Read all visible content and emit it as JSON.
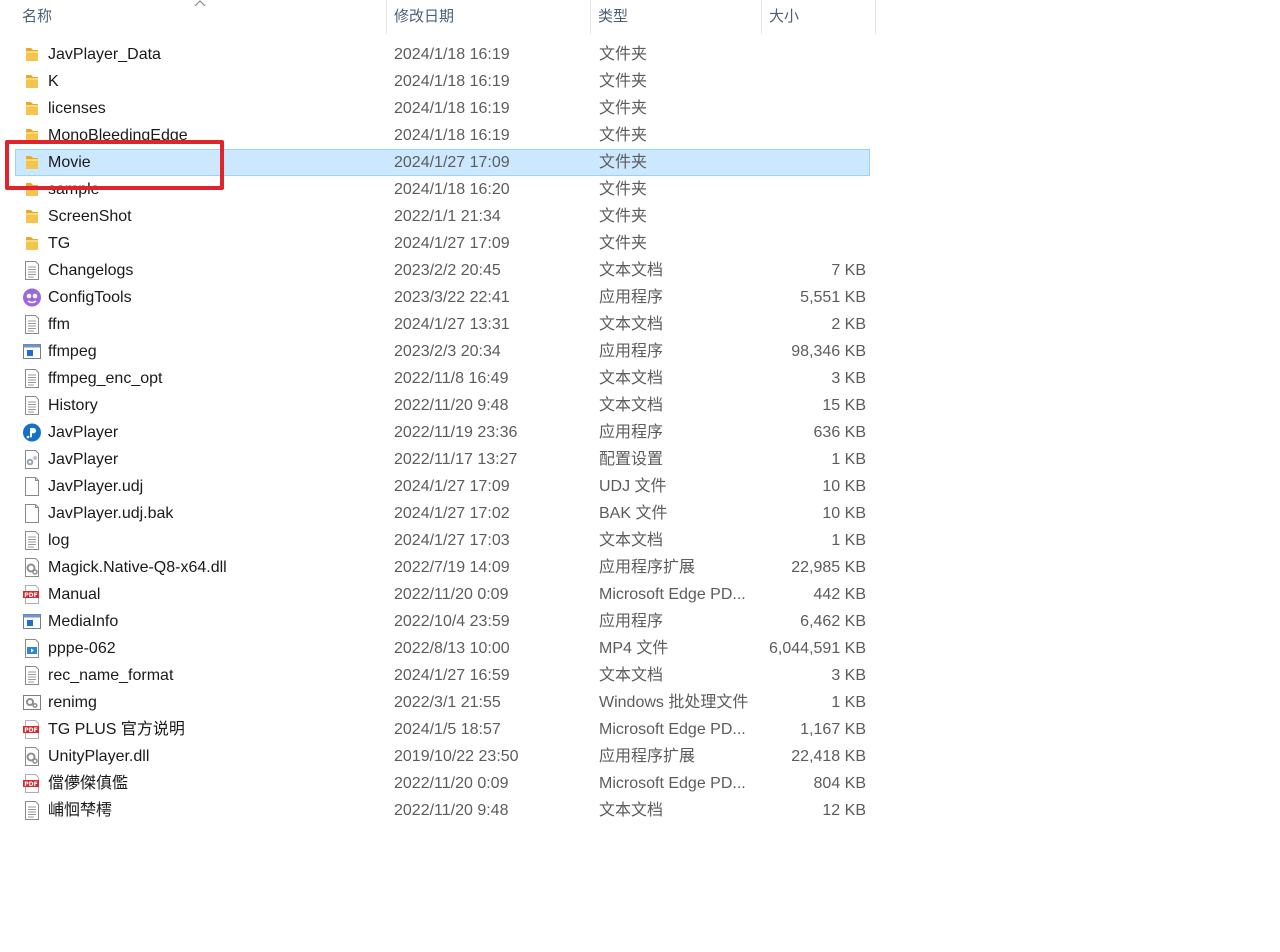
{
  "columns": {
    "name": "名称",
    "date": "修改日期",
    "type": "类型",
    "size": "大小"
  },
  "files": [
    {
      "name": "JavPlayer_Data",
      "date": "2024/1/18 16:19",
      "type": "文件夹",
      "size": "",
      "icon": "folder-icon"
    },
    {
      "name": "K",
      "date": "2024/1/18 16:19",
      "type": "文件夹",
      "size": "",
      "icon": "folder-icon"
    },
    {
      "name": "licenses",
      "date": "2024/1/18 16:19",
      "type": "文件夹",
      "size": "",
      "icon": "folder-icon"
    },
    {
      "name": "MonoBleedingEdge",
      "date": "2024/1/18 16:19",
      "type": "文件夹",
      "size": "",
      "icon": "folder-icon"
    },
    {
      "name": "Movie",
      "date": "2024/1/27 17:09",
      "type": "文件夹",
      "size": "",
      "icon": "folder-icon",
      "selected": true
    },
    {
      "name": "sample",
      "date": "2024/1/18 16:20",
      "type": "文件夹",
      "size": "",
      "icon": "folder-icon"
    },
    {
      "name": "ScreenShot",
      "date": "2022/1/1 21:34",
      "type": "文件夹",
      "size": "",
      "icon": "folder-icon"
    },
    {
      "name": "TG",
      "date": "2024/1/27 17:09",
      "type": "文件夹",
      "size": "",
      "icon": "folder-icon"
    },
    {
      "name": "Changelogs",
      "date": "2023/2/2 20:45",
      "type": "文本文档",
      "size": "7 KB",
      "icon": "text-document-icon"
    },
    {
      "name": "ConfigTools",
      "date": "2023/3/22 22:41",
      "type": "应用程序",
      "size": "5,551 KB",
      "icon": "config-tools-app-icon"
    },
    {
      "name": "ffm",
      "date": "2024/1/27 13:31",
      "type": "文本文档",
      "size": "2 KB",
      "icon": "text-document-icon"
    },
    {
      "name": "ffmpeg",
      "date": "2023/2/3 20:34",
      "type": "应用程序",
      "size": "98,346 KB",
      "icon": "application-window-icon"
    },
    {
      "name": "ffmpeg_enc_opt",
      "date": "2022/11/8 16:49",
      "type": "文本文档",
      "size": "3 KB",
      "icon": "text-document-icon"
    },
    {
      "name": "History",
      "date": "2022/11/20 9:48",
      "type": "文本文档",
      "size": "15 KB",
      "icon": "text-document-icon"
    },
    {
      "name": "JavPlayer",
      "date": "2022/11/19 23:36",
      "type": "应用程序",
      "size": "636 KB",
      "icon": "javplayer-app-icon"
    },
    {
      "name": "JavPlayer",
      "date": "2022/11/17 13:27",
      "type": "配置设置",
      "size": "1 KB",
      "icon": "config-settings-icon"
    },
    {
      "name": "JavPlayer.udj",
      "date": "2024/1/27 17:09",
      "type": "UDJ 文件",
      "size": "10 KB",
      "icon": "blank-file-icon"
    },
    {
      "name": "JavPlayer.udj.bak",
      "date": "2024/1/27 17:02",
      "type": "BAK 文件",
      "size": "10 KB",
      "icon": "blank-file-icon"
    },
    {
      "name": "log",
      "date": "2024/1/27 17:03",
      "type": "文本文档",
      "size": "1 KB",
      "icon": "text-document-icon"
    },
    {
      "name": "Magick.Native-Q8-x64.dll",
      "date": "2022/7/19 14:09",
      "type": "应用程序扩展",
      "size": "22,985 KB",
      "icon": "dll-gear-icon"
    },
    {
      "name": "Manual",
      "date": "2022/11/20 0:09",
      "type": "Microsoft Edge PD...",
      "size": "442 KB",
      "icon": "pdf-icon"
    },
    {
      "name": "MediaInfo",
      "date": "2022/10/4 23:59",
      "type": "应用程序",
      "size": "6,462 KB",
      "icon": "application-window-icon"
    },
    {
      "name": "pppe-062",
      "date": "2022/8/13 10:00",
      "type": "MP4 文件",
      "size": "6,044,591 KB",
      "icon": "video-file-icon"
    },
    {
      "name": "rec_name_format",
      "date": "2024/1/27 16:59",
      "type": "文本文档",
      "size": "3 KB",
      "icon": "text-document-icon"
    },
    {
      "name": "renimg",
      "date": "2022/3/1 21:55",
      "type": "Windows 批处理文件",
      "size": "1 KB",
      "icon": "batch-file-icon"
    },
    {
      "name": "TG PLUS 官方说明",
      "date": "2024/1/5 18:57",
      "type": "Microsoft Edge PD...",
      "size": "1,167 KB",
      "icon": "pdf-icon"
    },
    {
      "name": "UnityPlayer.dll",
      "date": "2019/10/22 23:50",
      "type": "应用程序扩展",
      "size": "22,418 KB",
      "icon": "dll-gear-icon"
    },
    {
      "name": "儅儚傑傎儖",
      "date": "2022/11/20 0:09",
      "type": "Microsoft Edge PD...",
      "size": "804 KB",
      "icon": "pdf-icon"
    },
    {
      "name": "峬恛梺樗",
      "date": "2022/11/20 9:48",
      "type": "文本文档",
      "size": "12 KB",
      "icon": "text-document-icon"
    }
  ],
  "colors": {
    "selection_fill": "#cce8ff",
    "selection_border": "#99d1ff",
    "highlight_box": "#e0242c",
    "folder": "#f4c44e"
  }
}
